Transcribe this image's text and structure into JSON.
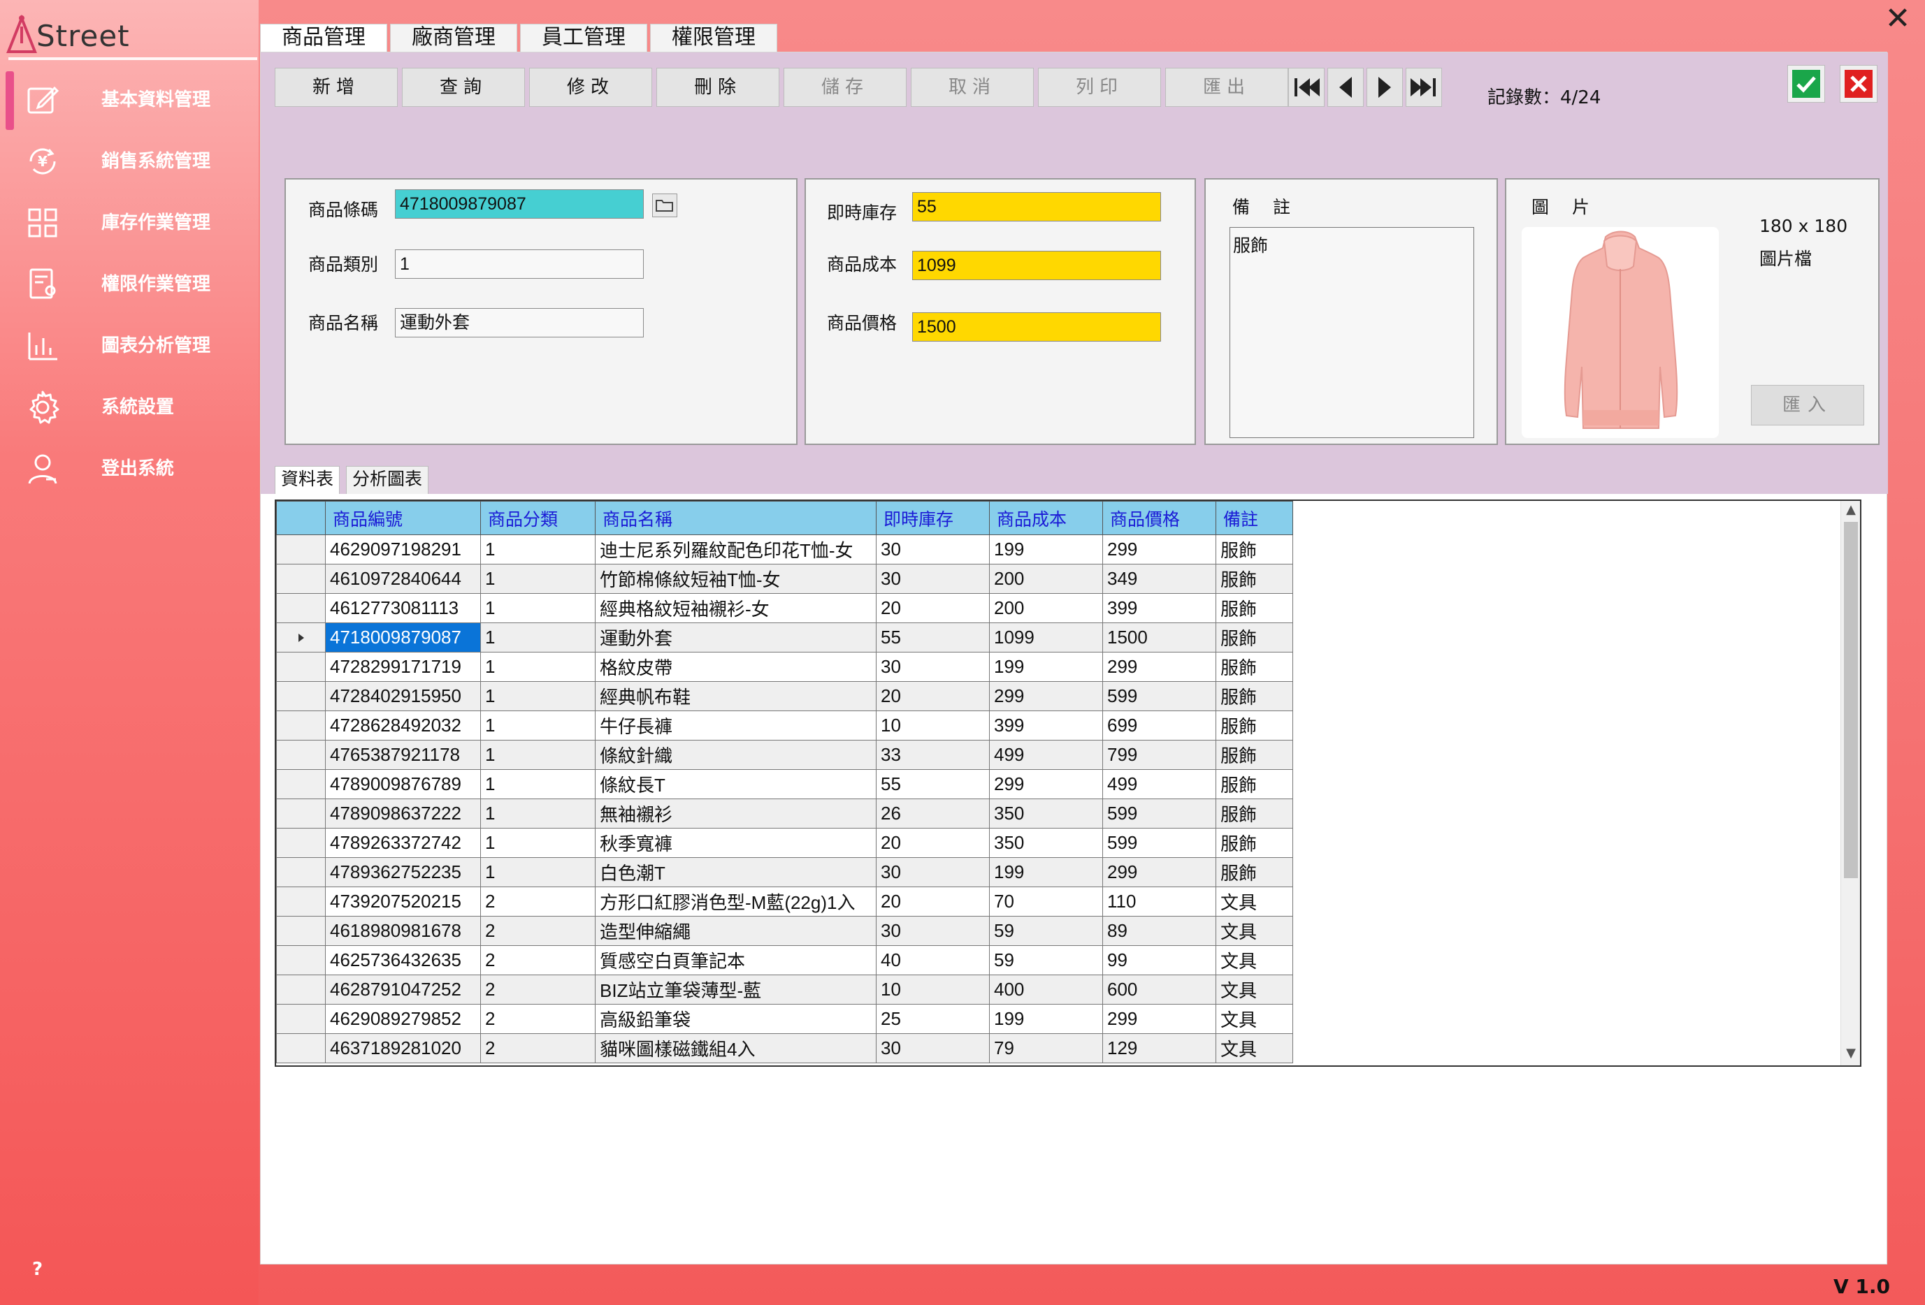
{
  "app": {
    "logo_text": "Street",
    "version": "V 1.0",
    "help": "?"
  },
  "sidebar": {
    "items": [
      {
        "label": "基本資料管理",
        "icon": "edit-icon"
      },
      {
        "label": "銷售系統管理",
        "icon": "yen-cycle-icon"
      },
      {
        "label": "庫存作業管理",
        "icon": "grid-icon"
      },
      {
        "label": "權限作業管理",
        "icon": "document-user-icon"
      },
      {
        "label": "圖表分析管理",
        "icon": "bar-chart-icon"
      },
      {
        "label": "系統設置",
        "icon": "gear-icon"
      },
      {
        "label": "登出系統",
        "icon": "user-icon"
      }
    ]
  },
  "main_tabs": [
    "商品管理",
    "廠商管理",
    "員工管理",
    "權限管理"
  ],
  "toolbar": {
    "buttons": [
      "新增",
      "查詢",
      "修改",
      "刪除",
      "儲存",
      "取消",
      "列印",
      "匯出"
    ],
    "records_label": "記錄數：4/24"
  },
  "form": {
    "barcode_label": "商品條碼",
    "barcode_value": "4718009879087",
    "category_label": "商品類別",
    "category_value": "1",
    "name_label": "商品名稱",
    "name_value": "運動外套",
    "stock_label": "即時庫存",
    "stock_value": "55",
    "cost_label": "商品成本",
    "cost_value": "1099",
    "price_label": "商品價格",
    "price_value": "1500",
    "memo_label": "備　註",
    "memo_value": "服飾",
    "image_label": "圖　片",
    "image_size": "180 x 180",
    "image_type": "圖片檔",
    "import_label": "匯入"
  },
  "sub_tabs": [
    "資料表",
    "分析圖表"
  ],
  "grid": {
    "columns": [
      "商品編號",
      "商品分類",
      "商品名稱",
      "即時庫存",
      "商品成本",
      "商品價格",
      "備註"
    ],
    "rows": [
      [
        "4629097198291",
        "1",
        "迪士尼系列羅紋配色印花T恤-女",
        "30",
        "199",
        "299",
        "服飾"
      ],
      [
        "4610972840644",
        "1",
        "竹節棉條紋短袖T恤-女",
        "30",
        "200",
        "349",
        "服飾"
      ],
      [
        "4612773081113",
        "1",
        "經典格紋短袖襯衫-女",
        "20",
        "200",
        "399",
        "服飾"
      ],
      [
        "4718009879087",
        "1",
        "運動外套",
        "55",
        "1099",
        "1500",
        "服飾"
      ],
      [
        "4728299171719",
        "1",
        "格紋皮帶",
        "30",
        "199",
        "299",
        "服飾"
      ],
      [
        "4728402915950",
        "1",
        "經典帆布鞋",
        "20",
        "299",
        "599",
        "服飾"
      ],
      [
        "4728628492032",
        "1",
        "牛仔長褲",
        "10",
        "399",
        "699",
        "服飾"
      ],
      [
        "4765387921178",
        "1",
        "條紋針織",
        "33",
        "499",
        "799",
        "服飾"
      ],
      [
        "4789009876789",
        "1",
        "條紋長T",
        "55",
        "299",
        "499",
        "服飾"
      ],
      [
        "4789098637222",
        "1",
        "無袖襯衫",
        "26",
        "350",
        "599",
        "服飾"
      ],
      [
        "4789263372742",
        "1",
        "秋季寬褲",
        "20",
        "350",
        "599",
        "服飾"
      ],
      [
        "4789362752235",
        "1",
        "白色潮T",
        "30",
        "199",
        "299",
        "服飾"
      ],
      [
        "4739207520215",
        "2",
        "方形口紅膠消色型-M藍(22g)1入",
        "20",
        "70",
        "110",
        "文具"
      ],
      [
        "4618980981678",
        "2",
        "造型伸縮繩",
        "30",
        "59",
        "89",
        "文具"
      ],
      [
        "4625736432635",
        "2",
        "質感空白頁筆記本",
        "40",
        "59",
        "99",
        "文具"
      ],
      [
        "4628791047252",
        "2",
        "BIZ站立筆袋薄型-藍",
        "10",
        "400",
        "600",
        "文具"
      ],
      [
        "4629089279852",
        "2",
        "高級鉛筆袋",
        "25",
        "199",
        "299",
        "文具"
      ],
      [
        "4637189281020",
        "2",
        "貓咪圖樣磁鐵組4入",
        "30",
        "79",
        "129",
        "文具"
      ]
    ],
    "selected_row": 3
  }
}
